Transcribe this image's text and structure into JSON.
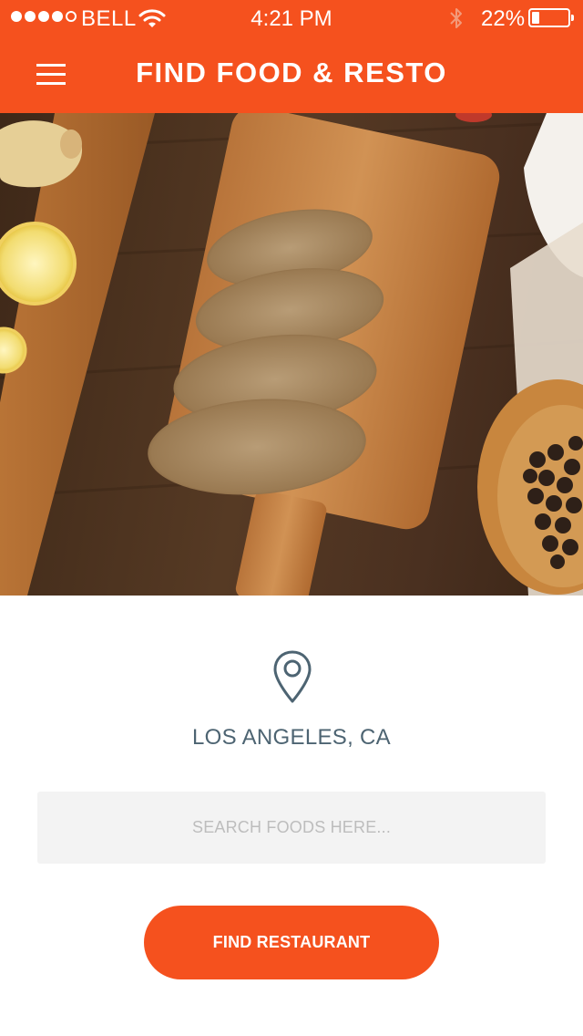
{
  "status_bar": {
    "carrier": "BELL",
    "time": "4:21 PM",
    "battery": "22%",
    "battery_level": 0.22,
    "signal_bars_filled": 4,
    "signal_bars_total": 5
  },
  "header": {
    "title": "FIND FOOD & RESTO",
    "menu_icon": "hamburger-menu-icon"
  },
  "hero": {
    "image": "bread-on-cutting-board-photo"
  },
  "location": {
    "icon": "map-pin-icon",
    "label": "LOS ANGELES, CA"
  },
  "search": {
    "placeholder": "SEARCH FOODS HERE...",
    "value": ""
  },
  "actions": {
    "find_label": "FIND RESTAURANT"
  },
  "colors": {
    "accent": "#f5511e",
    "text_muted": "#4d6472",
    "input_bg": "#f3f3f3"
  }
}
